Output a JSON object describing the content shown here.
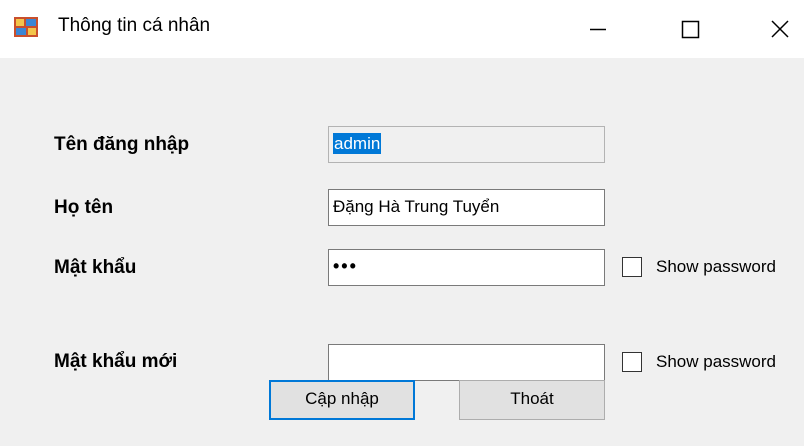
{
  "window": {
    "title": "Thông tin cá nhân",
    "icon": "form-app-icon",
    "controls": [
      "minimize-icon",
      "maximize-icon",
      "close-icon"
    ]
  },
  "form": {
    "username": {
      "label": "Tên đăng nhập",
      "value": "admin",
      "read_only": true,
      "selected": true
    },
    "fullname": {
      "label": "Họ tên",
      "value": "Đặng Hà Trung Tuyển"
    },
    "password": {
      "label": "Mật khẩu",
      "masked_value": "•••",
      "show_password_label": "Show password",
      "show_password_checked": false
    },
    "new_password": {
      "label": "Mật khẩu mới",
      "value": "",
      "show_password_label": "Show password",
      "show_password_checked": false
    }
  },
  "buttons": {
    "update_label": "Cập nhập",
    "exit_label": "Thoát"
  },
  "colors": {
    "selection": "#0078d7",
    "client_background": "#f0f0f0",
    "default_button_border": "#0078d7"
  }
}
